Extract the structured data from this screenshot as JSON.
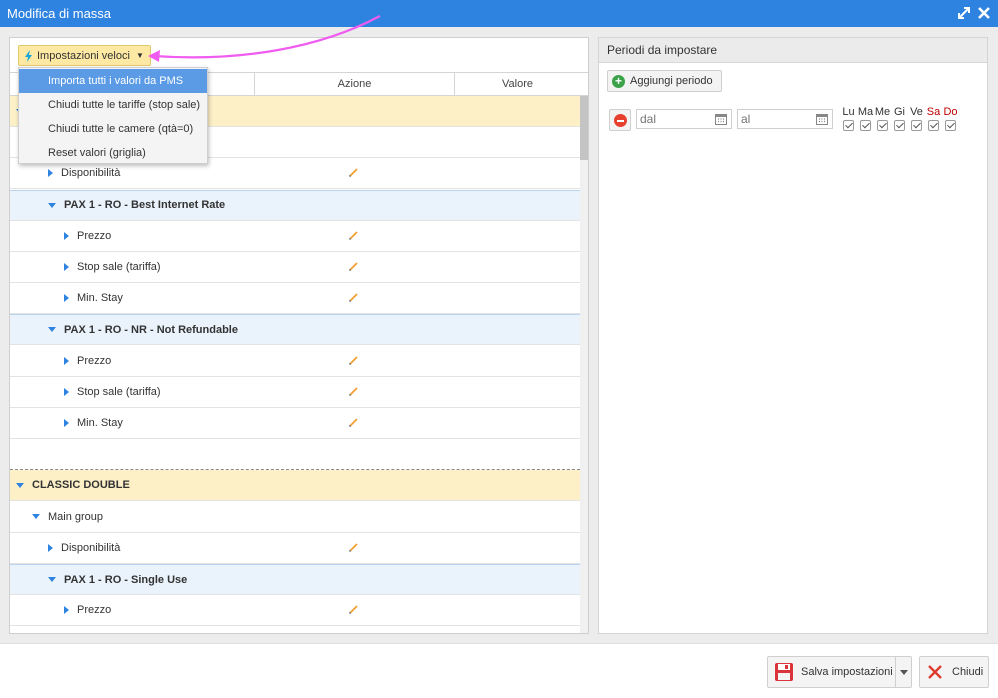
{
  "window": {
    "title": "Modifica di massa"
  },
  "toolbar": {
    "quick_settings_label": "Impostazioni veloci"
  },
  "dropdown": {
    "items": [
      {
        "label": "Importa tutti i valori da PMS",
        "active": true
      },
      {
        "label": "Chiudi tutte le tariffe (stop sale)"
      },
      {
        "label": "Chiudi tutte le camere (qtà=0)"
      },
      {
        "label": "Reset valori (griglia)"
      }
    ]
  },
  "grid": {
    "columns": [
      "",
      "Azione",
      "Valore"
    ],
    "rows": [
      {
        "type": "room",
        "label": "",
        "indent": 0,
        "expanded": true
      },
      {
        "type": "group",
        "label": "",
        "indent": 1,
        "expanded": true
      },
      {
        "type": "item",
        "label": "Disponibilità",
        "indent": 2,
        "editable": true
      },
      {
        "type": "rate",
        "label": "PAX 1 - RO - Best Internet Rate",
        "indent": 2,
        "expanded": true
      },
      {
        "type": "item",
        "label": "Prezzo",
        "indent": 3,
        "editable": true
      },
      {
        "type": "item",
        "label": "Stop sale (tariffa)",
        "indent": 3,
        "editable": true
      },
      {
        "type": "item",
        "label": "Min. Stay",
        "indent": 3,
        "editable": true
      },
      {
        "type": "rate",
        "label": "PAX 1 - RO - NR - Not Refundable",
        "indent": 2,
        "expanded": true
      },
      {
        "type": "item",
        "label": "Prezzo",
        "indent": 3,
        "editable": true
      },
      {
        "type": "item",
        "label": "Stop sale (tariffa)",
        "indent": 3,
        "editable": true
      },
      {
        "type": "item",
        "label": "Min. Stay",
        "indent": 3,
        "editable": true
      },
      {
        "type": "sep",
        "label": ""
      },
      {
        "type": "room",
        "label": "CLASSIC DOUBLE",
        "indent": 0,
        "expanded": true
      },
      {
        "type": "group",
        "label": "Main group",
        "indent": 1,
        "expanded": true
      },
      {
        "type": "item",
        "label": "Disponibilità",
        "indent": 2,
        "editable": true
      },
      {
        "type": "rate",
        "label": "PAX 1 - RO - Single Use",
        "indent": 2,
        "expanded": true
      },
      {
        "type": "item",
        "label": "Prezzo",
        "indent": 3,
        "editable": true
      }
    ]
  },
  "periods": {
    "title": "Periodi da impostare",
    "add_label": "Aggiungi periodo",
    "from_placeholder": "dal",
    "to_placeholder": "al",
    "days": [
      {
        "label": "Lu",
        "checked": true,
        "weekend": false
      },
      {
        "label": "Ma",
        "checked": true,
        "weekend": false
      },
      {
        "label": "Me",
        "checked": true,
        "weekend": false
      },
      {
        "label": "Gi",
        "checked": true,
        "weekend": false
      },
      {
        "label": "Ve",
        "checked": true,
        "weekend": false
      },
      {
        "label": "Sa",
        "checked": true,
        "weekend": true
      },
      {
        "label": "Do",
        "checked": true,
        "weekend": true
      }
    ]
  },
  "footer": {
    "save_label": "Salva impostazioni",
    "close_label": "Chiudi"
  },
  "colors": {
    "titlebar": "#2f83e0",
    "room_row": "#fdf0c7",
    "rate_row": "#eaf3fc",
    "menu_active": "#5b9be6",
    "annotation_arrow": "#f05cf0",
    "weekend": "#c00000"
  }
}
